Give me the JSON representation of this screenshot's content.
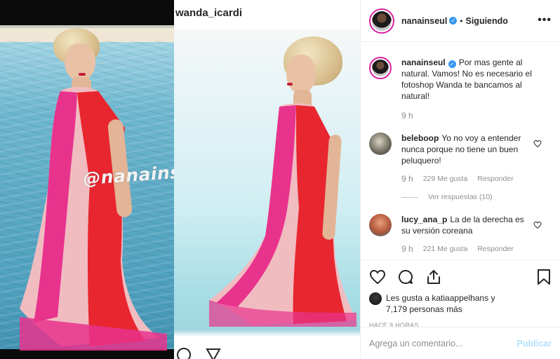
{
  "media": {
    "watermark": "@nanainseul",
    "cropped_username": "wanda_icardi"
  },
  "post": {
    "username": "nanainseul",
    "separator": "•",
    "follow_state": "Siguiendo",
    "more_label": "•••"
  },
  "caption": {
    "username": "nanainseul",
    "text": "Por mas gente al natural. Vamos! No es necesario el fotoshop Wanda te bancamos al natural!",
    "time": "9 h"
  },
  "comments": [
    {
      "username": "beleboop",
      "text": "Yo no voy a entender nunca porque no tiene un buen peluquero!",
      "time": "9 h",
      "likes": "229 Me gusta",
      "reply_label": "Responder",
      "view_replies": "Ver respuestas (10)"
    },
    {
      "username": "lucy_ana_p",
      "text": "La de la derecha es su versión coreana",
      "time": "9 h",
      "likes": "221 Me gusta",
      "reply_label": "Responder"
    }
  ],
  "likes_summary": {
    "line1": "Les gusta a katiaappelhans y",
    "line2": "7,179 personas más"
  },
  "time_ago": "HACE 9 HORAS",
  "add_comment": {
    "placeholder": "Agrega un comentario...",
    "publish_label": "Publicar"
  },
  "colors": {
    "accent_blue": "#3897f0",
    "publish_disabled": "#b2dffc",
    "muted_text": "#8e8e8e",
    "dress_red": "#e8262f",
    "dress_pink": "#e8338d"
  },
  "icons": [
    "heart-icon",
    "comment-icon",
    "share-icon",
    "bookmark-icon",
    "verified-badge-icon",
    "more-options-icon"
  ]
}
